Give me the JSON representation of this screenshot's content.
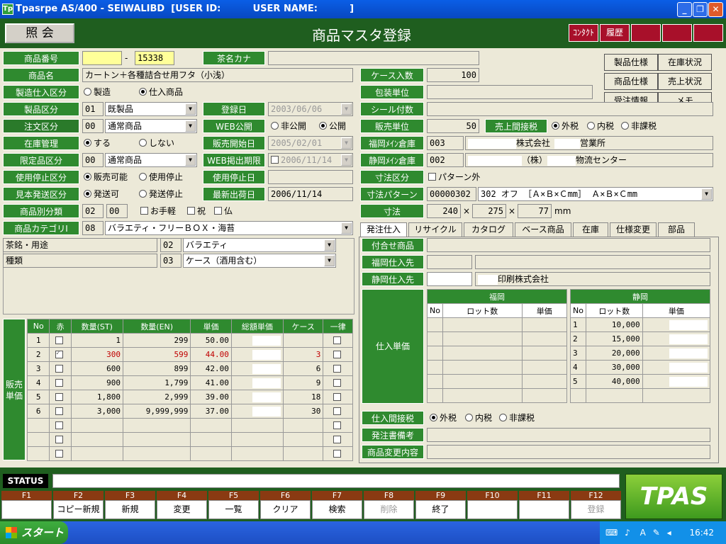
{
  "window": {
    "title": "Tpasrpe AS/400 - SEIWALIBD  [USER ID:          USER NAME:          ]",
    "app_icon": "Tp"
  },
  "header": {
    "mode_label": "照 会",
    "title": "商品マスタ登録",
    "right_buttons": [
      "ｺﾝﾀｸﾄ",
      "履歴",
      "",
      "",
      ""
    ]
  },
  "side_buttons": [
    "製品仕様",
    "在庫状況",
    "商品仕様",
    "売上状況",
    "受注情報",
    "メモ"
  ],
  "form": {
    "product_no_label": "商品番号",
    "product_no_a": "",
    "product_no_sep": "-",
    "product_no_b": "15338",
    "tea_kana_label": "茶名カナ",
    "tea_kana": "",
    "product_name_label": "商品名",
    "product_name": "カートン＋各種詰合せ用フタ（小浅）",
    "case_qty_label": "ケース入数",
    "case_qty": "100",
    "mfg_label": "製造仕入区分",
    "mfg_opt1": "製造",
    "mfg_opt2": "仕入商品",
    "pack_unit_label": "包装単位",
    "pack_unit": "",
    "prod_class_label": "製品区分",
    "prod_class_code": "01",
    "prod_class": "既製品",
    "reg_date_label": "登録日",
    "reg_date": "2003/06/06",
    "seal_label": "シール付数",
    "seal": "",
    "order_class_label": "注文区分",
    "order_class_code": "00",
    "order_class": "通常商品",
    "web_label": "WEB公開",
    "web_opt1": "非公開",
    "web_opt2": "公開",
    "sales_unit_label": "販売単位",
    "sales_unit": "50",
    "tax_label": "売上間接税",
    "tax_opt1": "外税",
    "tax_opt2": "内税",
    "tax_opt3": "非課税",
    "stock_label": "在庫管理",
    "stock_opt1": "する",
    "stock_opt2": "しない",
    "sale_start_label": "販売開始日",
    "sale_start": "2005/02/01",
    "fukuoka_wh_label": "福岡ﾒｲﾝ倉庫",
    "fukuoka_wh_code": "003",
    "fukuoka_wh_a": "株式会社",
    "fukuoka_wh_b": "営業所",
    "limited_label": "限定品区分",
    "limited_code": "00",
    "limited": "通常商品",
    "web_end_label": "WEB掲出期限",
    "web_end": "2006/11/14",
    "shizuoka_wh_label": "静岡ﾒｲﾝ倉庫",
    "shizuoka_wh_code": "002",
    "shizuoka_wh_a": "（株）",
    "shizuoka_wh_b": "物流センター",
    "stop_class_label": "使用停止区分",
    "stop_opt1": "販売可能",
    "stop_opt2": "使用停止",
    "stop_date_label": "使用停止日",
    "stop_date": "",
    "size_class_label": "寸法区分",
    "size_class": "パターン外",
    "sample_label": "見本発送区分",
    "sample_opt1": "発送可",
    "sample_opt2": "発送停止",
    "last_ship_label": "最新出荷日",
    "last_ship": "2006/11/14",
    "size_pattern_label": "寸法パターン",
    "size_pattern_code": "00000302",
    "size_pattern": "302 オフ ［Ａ×Ｂ×Ｃmm］  Ａ×Ｂ×Ｃmm",
    "sub_class_label": "商品別分類",
    "sub_class_a": "02",
    "sub_class_b": "00",
    "sub_chk1": "お手軽",
    "sub_chk2": "祝",
    "sub_chk3": "仏",
    "dims_label": "寸法",
    "dim_a": "240",
    "dim_b": "275",
    "dim_c": "77",
    "dim_x": "×",
    "dim_unit": "mm",
    "category_label": "商品カテゴリⅠ",
    "category_code": "08",
    "category": "バラエティ・フリーＢＯＸ・海苔"
  },
  "attrs": [
    {
      "name": "茶銘・用途",
      "code": "02",
      "value": "バラエティ"
    },
    {
      "name": "種類",
      "code": "03",
      "value": "ケース（酒用含む）"
    }
  ],
  "price_table": {
    "side_label": "販売単価",
    "headers": [
      "No",
      "赤",
      "数量(ST)",
      "数量(EN)",
      "単価",
      "総額単価",
      "ケース",
      "一律"
    ],
    "rows": [
      {
        "no": "1",
        "st": "1",
        "en": "299",
        "price": "50.00",
        "case": "",
        "red": false
      },
      {
        "no": "2",
        "st": "300",
        "en": "599",
        "price": "44.00",
        "case": "3",
        "red": true
      },
      {
        "no": "3",
        "st": "600",
        "en": "899",
        "price": "42.00",
        "case": "6",
        "red": false
      },
      {
        "no": "4",
        "st": "900",
        "en": "1,799",
        "price": "41.00",
        "case": "9",
        "red": false
      },
      {
        "no": "5",
        "st": "1,800",
        "en": "2,999",
        "price": "39.00",
        "case": "18",
        "red": false
      },
      {
        "no": "6",
        "st": "3,000",
        "en": "9,999,999",
        "price": "37.00",
        "case": "30",
        "red": false
      }
    ]
  },
  "tabs": [
    "発注仕入",
    "リサイクル",
    "カタログ",
    "ベース商品",
    "在庫",
    "仕様変更",
    "部品"
  ],
  "purchase": {
    "assort_label": "付合せ商品",
    "assort": "",
    "fukuoka_sup_label": "福岡仕入先",
    "fukuoka_sup": "",
    "shizuoka_sup_label": "静岡仕入先",
    "shizuoka_sup": "印刷株式会社",
    "unit_price_label": "仕入単価",
    "fukuoka_head": "福岡",
    "shizuoka_head": "静岡",
    "sub_headers": [
      "No",
      "ロット数",
      "単価"
    ],
    "shizuoka_rows": [
      {
        "no": "1",
        "lot": "10,000"
      },
      {
        "no": "2",
        "lot": "15,000"
      },
      {
        "no": "3",
        "lot": "20,000"
      },
      {
        "no": "4",
        "lot": "30,000"
      },
      {
        "no": "5",
        "lot": "40,000"
      }
    ],
    "ptax_label": "仕入間接税",
    "ptax_opt1": "外税",
    "ptax_opt2": "内税",
    "ptax_opt3": "非課税",
    "po_note_label": "発注書備考",
    "po_note": "",
    "change_label": "商品変更内容",
    "change": ""
  },
  "status": {
    "label": "STATUS",
    "text": ""
  },
  "fkeys": [
    {
      "key": "F1",
      "label": ""
    },
    {
      "key": "F2",
      "label": "コピー新規"
    },
    {
      "key": "F3",
      "label": "新規"
    },
    {
      "key": "F4",
      "label": "変更"
    },
    {
      "key": "F5",
      "label": "一覧"
    },
    {
      "key": "F6",
      "label": "クリア"
    },
    {
      "key": "F7",
      "label": "検索"
    },
    {
      "key": "F8",
      "label": "削除"
    },
    {
      "key": "F9",
      "label": "終了"
    },
    {
      "key": "F10",
      "label": ""
    },
    {
      "key": "F11",
      "label": ""
    },
    {
      "key": "F12",
      "label": "登録"
    }
  ],
  "brand": "TPAS",
  "taskbar": {
    "start": "スタート",
    "clock": "16:42",
    "ime": "A"
  }
}
